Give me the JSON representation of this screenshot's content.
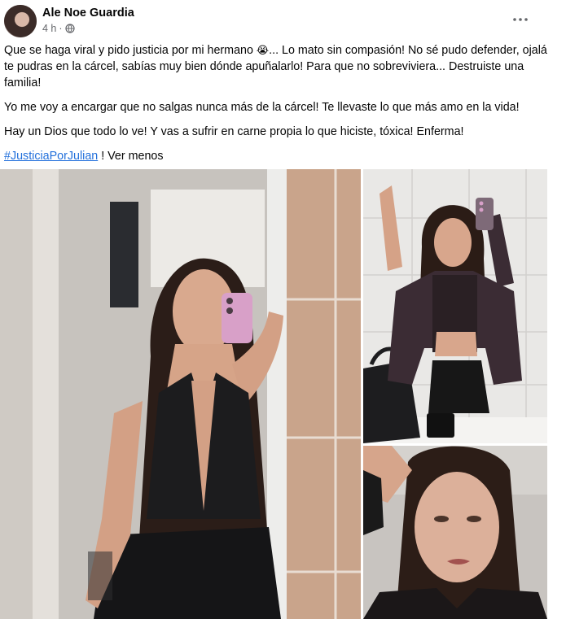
{
  "post": {
    "author_name": "Ale Noe Guardia",
    "timestamp": "4 h",
    "separator": "·",
    "privacy_icon": "globe-icon",
    "more_options_icon": "more-horizontal-icon",
    "paragraph1_part1": "Que se haga viral y pido justicia por mi hermano ",
    "paragraph1_emoji": "😭",
    "paragraph1_part2": "... Lo mato sin compasión! No sé pudo defender, ojalá te pudras en la cárcel, sabías muy bien dónde apuñalarlo! Para que no sobreviviera... Destruiste una familia!",
    "paragraph2": "Yo me voy a encargar que no salgas nunca más de la cárcel! Te llevaste lo que más amo en la vida!",
    "paragraph3": "Hay un Dios que todo lo ve! Y vas a sufrir en carne propia lo que hiciste, tóxica! Enferma!",
    "hashtag": "#JusticiaPorJulian",
    "hashtag_suffix": " ! ",
    "see_less": "Ver menos"
  },
  "colors": {
    "link": "#216fdb",
    "secondary_text": "#65676b",
    "primary_text": "#050505",
    "phone_case": "#d8a0c8"
  }
}
